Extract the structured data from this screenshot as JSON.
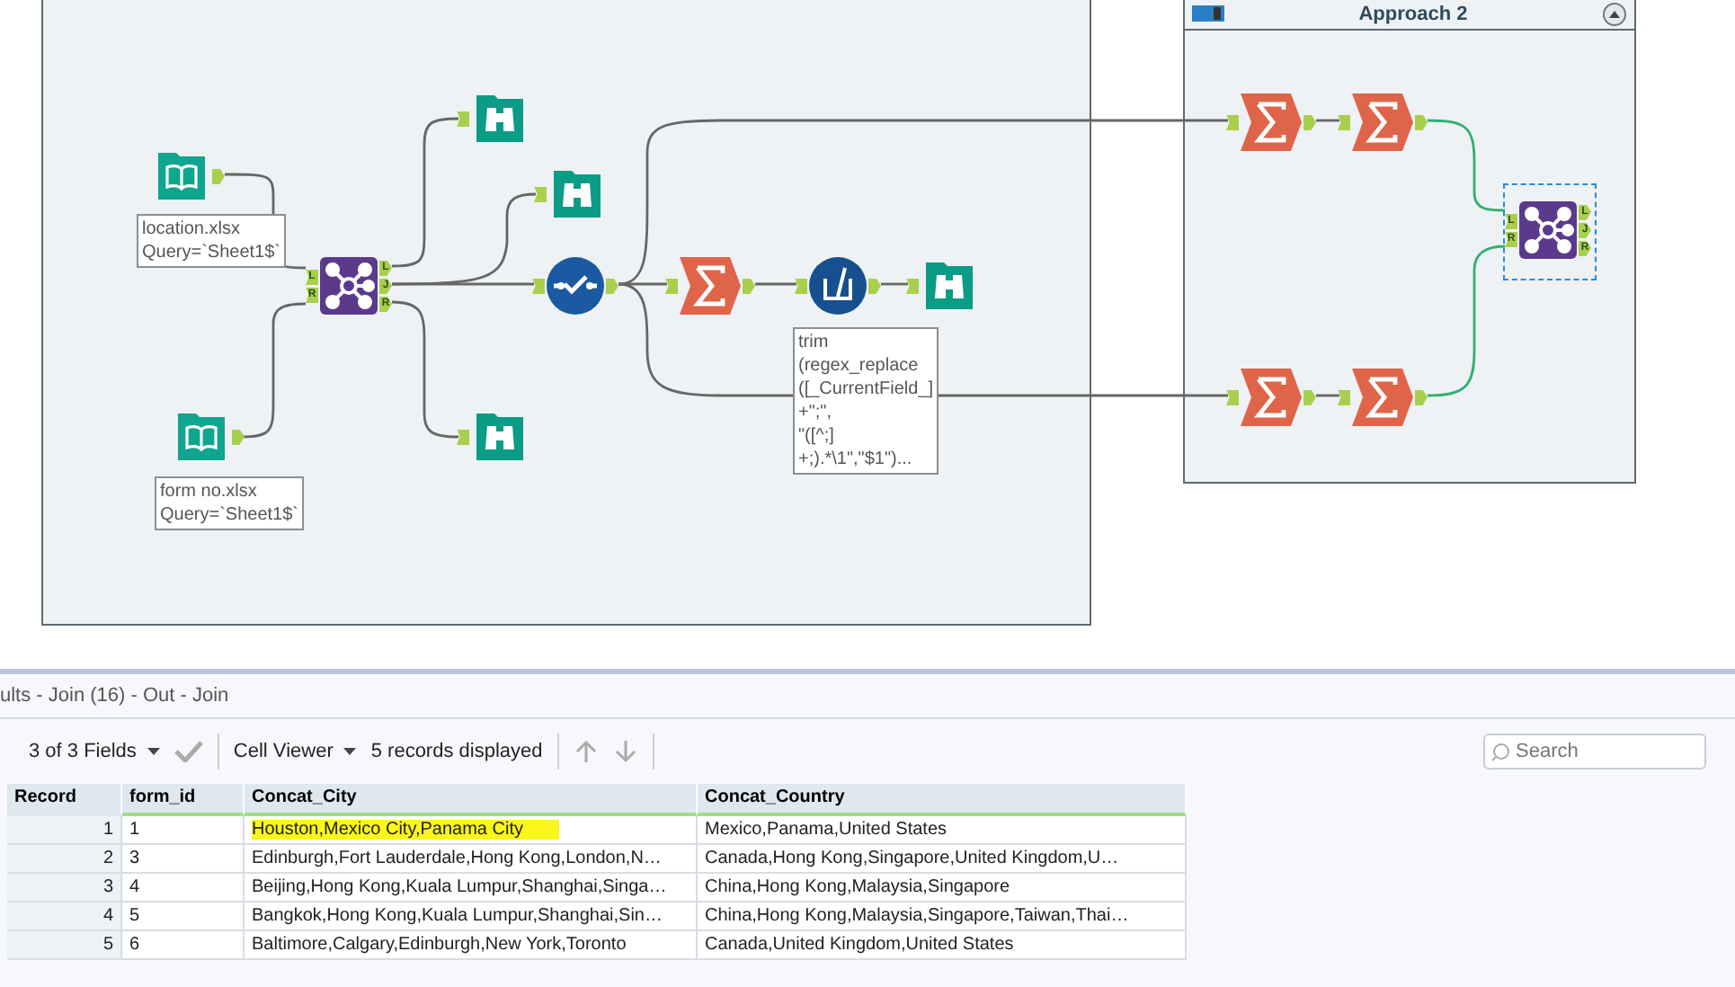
{
  "workflow": {
    "containers": [
      {
        "kind": "plain"
      },
      {
        "kind": "titled",
        "title": "Approach 2",
        "collapse_icon": true
      }
    ],
    "tools": [
      {
        "kind": "input",
        "selected": false,
        "annotation": "location.xlsx\nQuery=`Sheet1$`"
      },
      {
        "kind": "input",
        "selected": false,
        "annotation": "form no.xlsx\nQuery=`Sheet1$`"
      },
      {
        "kind": "join",
        "selected": false,
        "input_anchors": [
          "L",
          "R"
        ],
        "output_anchors": [
          "L",
          "J",
          "R"
        ]
      },
      {
        "kind": "browse",
        "selected": false
      },
      {
        "kind": "browse",
        "selected": false
      },
      {
        "kind": "browse",
        "selected": false
      },
      {
        "kind": "unique",
        "selected": false
      },
      {
        "kind": "summarize",
        "selected": false
      },
      {
        "kind": "formula",
        "selected": false,
        "annotation": "trim\n(regex_replace\n([_CurrentField_]\n+\";\",\n\"([^;]\n+;).*\\1\",\"$1\")..."
      },
      {
        "kind": "browse",
        "selected": false
      },
      {
        "kind": "summarize",
        "selected": false
      },
      {
        "kind": "summarize",
        "selected": false
      },
      {
        "kind": "summarize",
        "selected": false
      },
      {
        "kind": "summarize",
        "selected": false
      },
      {
        "kind": "join",
        "selected": true,
        "input_anchors": [
          "L",
          "R"
        ],
        "output_anchors": [
          "L",
          "J",
          "R"
        ]
      }
    ]
  },
  "results": {
    "title": "ults - Join (16) - Out - Join",
    "toolbar": {
      "fields_menu": "3 of 3 Fields",
      "viewer_menu": "Cell Viewer",
      "record_count": "5 records displayed",
      "search": {
        "placeholder": "Search"
      }
    },
    "table": {
      "columns": [
        "Record",
        "form_id",
        "Concat_City",
        "Concat_Country"
      ],
      "rows": [
        {
          "record": "1",
          "form_id": "1",
          "concat_city": "Houston,Mexico City,Panama City",
          "concat_country": "Mexico,Panama,United States",
          "highlighted": true
        },
        {
          "record": "2",
          "form_id": "3",
          "concat_city": "Edinburgh,Fort Lauderdale,Hong Kong,London,N…",
          "concat_country": "Canada,Hong Kong,Singapore,United Kingdom,U…",
          "highlighted": false
        },
        {
          "record": "3",
          "form_id": "4",
          "concat_city": "Beijing,Hong Kong,Kuala Lumpur,Shanghai,Singa…",
          "concat_country": "China,Hong Kong,Malaysia,Singapore",
          "highlighted": false
        },
        {
          "record": "4",
          "form_id": "5",
          "concat_city": "Bangkok,Hong Kong,Kuala Lumpur,Shanghai,Sin…",
          "concat_country": "China,Hong Kong,Malaysia,Singapore,Taiwan,Thai…",
          "highlighted": false
        },
        {
          "record": "5",
          "form_id": "6",
          "concat_city": "Baltimore,Calgary,Edinburgh,New York,Toronto",
          "concat_country": "Canada,United Kingdom,United States",
          "highlighted": false
        }
      ]
    }
  }
}
